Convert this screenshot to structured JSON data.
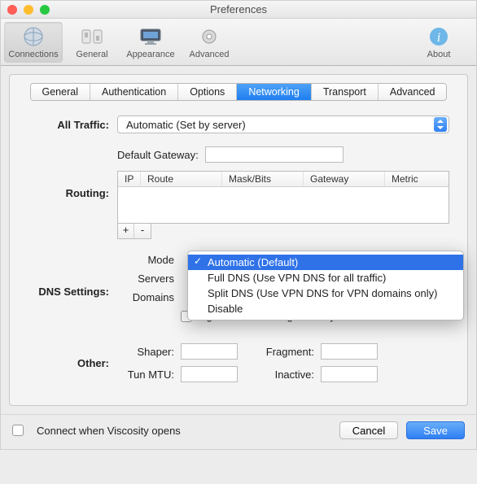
{
  "window": {
    "title": "Preferences"
  },
  "toolbar": {
    "items": [
      {
        "label": "Connections"
      },
      {
        "label": "General"
      },
      {
        "label": "Appearance"
      },
      {
        "label": "Advanced"
      }
    ],
    "about": "About"
  },
  "tabs": {
    "items": [
      "General",
      "Authentication",
      "Options",
      "Networking",
      "Transport",
      "Advanced"
    ],
    "selected": "Networking"
  },
  "allTraffic": {
    "label": "All Traffic:",
    "value": "Automatic (Set by server)"
  },
  "routing": {
    "label": "Routing:",
    "gateway_label": "Default Gateway:",
    "gateway_value": "",
    "columns": {
      "ip": "IP",
      "route": "Route",
      "mask": "Mask/Bits",
      "gateway": "Gateway",
      "metric": "Metric"
    },
    "add": "+",
    "remove": "-"
  },
  "dns": {
    "label": "DNS Settings:",
    "mode_label": "Mode",
    "servers_label": "Servers",
    "domains_label": "Domains",
    "ignore_label": "Ignore DNS settings sent by VPN server",
    "menu": {
      "items": [
        "Automatic (Default)",
        "Full DNS (Use VPN DNS for all traffic)",
        "Split DNS (Use VPN DNS for VPN domains only)",
        "Disable"
      ],
      "selected": "Automatic (Default)"
    }
  },
  "other": {
    "label": "Other:",
    "shaper_label": "Shaper:",
    "fragment_label": "Fragment:",
    "tunmtu_label": "Tun MTU:",
    "inactive_label": "Inactive:"
  },
  "footer": {
    "connect_label": "Connect when Viscosity opens",
    "cancel": "Cancel",
    "save": "Save"
  }
}
